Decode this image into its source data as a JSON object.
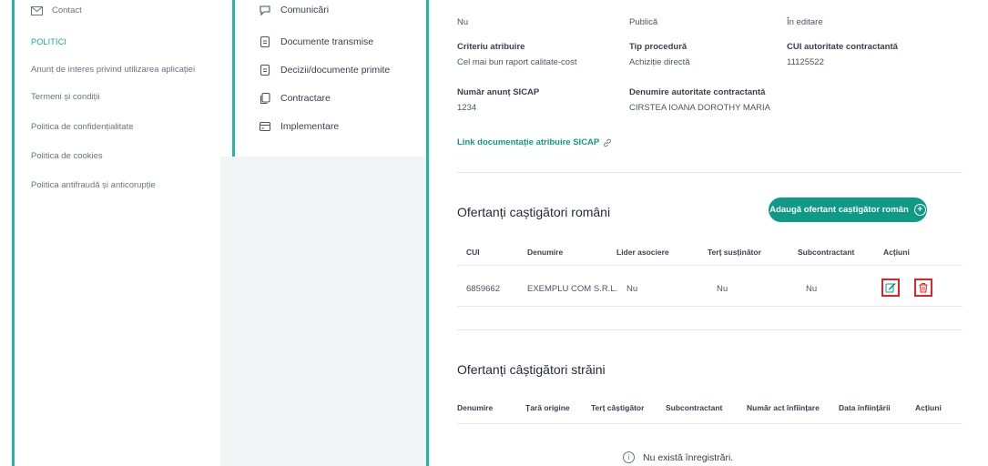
{
  "sidebar": {
    "contact": "Contact",
    "section_heading": "POLITICI",
    "items": [
      "Anunț de interes privind utilizarea aplicației",
      "Termeni și condiții",
      "Politica de confidențialitate",
      "Politica de cookies",
      "Politica antifraudă și anticorupție"
    ]
  },
  "subnav": {
    "items": [
      {
        "label": "Comunicări",
        "icon": "chat-icon"
      },
      {
        "label": "Documente transmise",
        "icon": "document-icon"
      },
      {
        "label": "Decizii/documente primite",
        "icon": "document-icon"
      },
      {
        "label": "Contractare",
        "icon": "copy-icon"
      },
      {
        "label": "Implementare",
        "icon": "card-icon"
      }
    ]
  },
  "details": {
    "row0": [
      "Nu",
      "Publică",
      "În editare"
    ],
    "row1_labels": [
      "Criteriu atribuire",
      "Tip procedură",
      "CUI autoritate contractantă"
    ],
    "row1_values": [
      "Cel mai bun raport calitate-cost",
      "Achiziție directă",
      "11125522"
    ],
    "row2_labels": [
      "Număr anunț SICAP",
      "Denumire autoritate contractantă"
    ],
    "row2_values": [
      "1234",
      "CIRSTEA IOANA DOROTHY MARIA"
    ],
    "link": "Link documentație atribuire SICAP"
  },
  "romanian_winners": {
    "title": "Ofertanți caștigători români",
    "add_button": "Adaugă ofertant caștigător român",
    "headers": [
      "CUI",
      "Denumire",
      "Lider asociere",
      "Terț susținător",
      "Subcontractant",
      "Acțiuni"
    ],
    "rows": [
      {
        "cui": "6859662",
        "denumire": "EXEMPLU COM S.R.L.",
        "lider": "Nu",
        "tert": "Nu",
        "subcontractant": "Nu"
      }
    ]
  },
  "foreign_winners": {
    "title": "Ofertanți câștigători străini",
    "headers": [
      "Denumire",
      "Țară origine",
      "Terț câștigător",
      "Subcontractant",
      "Număr act înființare",
      "Data înființării",
      "Acțiuni"
    ],
    "empty": "Nu există înregistrări."
  },
  "colors": {
    "accent": "#1fb8a3",
    "button": "#0f9a85",
    "danger": "#dc2626"
  }
}
